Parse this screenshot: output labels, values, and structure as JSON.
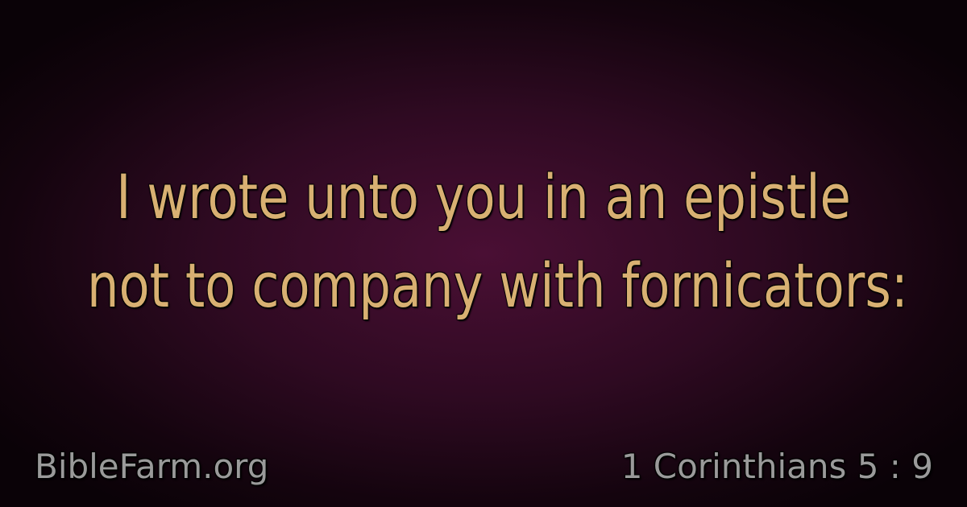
{
  "verse": {
    "lines": [
      "I wrote unto you in an epistle",
      "not to company with fornicators:"
    ]
  },
  "footer": {
    "site": "BibleFarm.org",
    "reference": "1 Corinthians 5 : 9"
  },
  "colors": {
    "verse_text": "#d8b072",
    "footer_text": "#9a9a9a",
    "background_center": "#4a0f34",
    "background_edge": "#0a0207"
  }
}
